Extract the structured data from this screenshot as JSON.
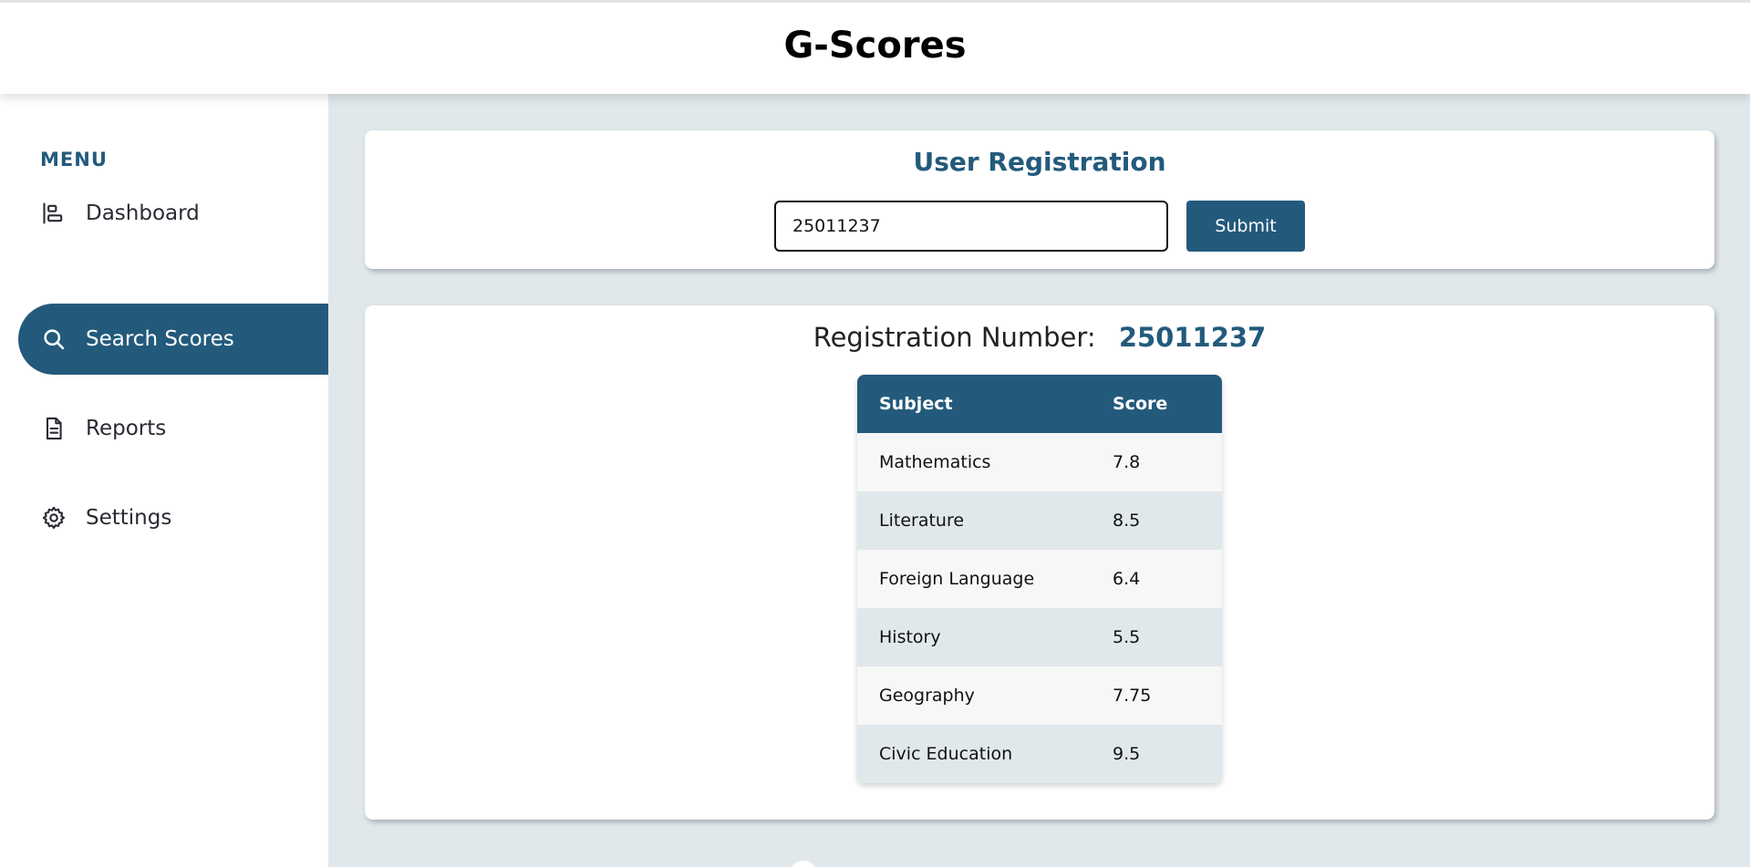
{
  "app": {
    "title": "G-Scores"
  },
  "sidebar": {
    "menu_title": "MENU",
    "items": [
      {
        "label": "Dashboard",
        "icon": "bar-chart-icon",
        "active": false
      },
      {
        "label": "Search Scores",
        "icon": "search-icon",
        "active": true
      },
      {
        "label": "Reports",
        "icon": "document-icon",
        "active": false
      },
      {
        "label": "Settings",
        "icon": "gear-icon",
        "active": false
      }
    ]
  },
  "registration": {
    "title": "User Registration",
    "input_value": "25011237",
    "submit_label": "Submit"
  },
  "result": {
    "label": "Registration Number:",
    "number": "25011237",
    "table": {
      "headers": [
        "Subject",
        "Score"
      ],
      "rows": [
        [
          "Mathematics",
          "7.8"
        ],
        [
          "Literature",
          "8.5"
        ],
        [
          "Foreign Language",
          "6.4"
        ],
        [
          "History",
          "5.5"
        ],
        [
          "Geography",
          "7.75"
        ],
        [
          "Civic Education",
          "9.5"
        ]
      ]
    }
  },
  "colors": {
    "accent": "#235a7c",
    "background": "#e1e8ec",
    "surface": "#ffffff"
  }
}
